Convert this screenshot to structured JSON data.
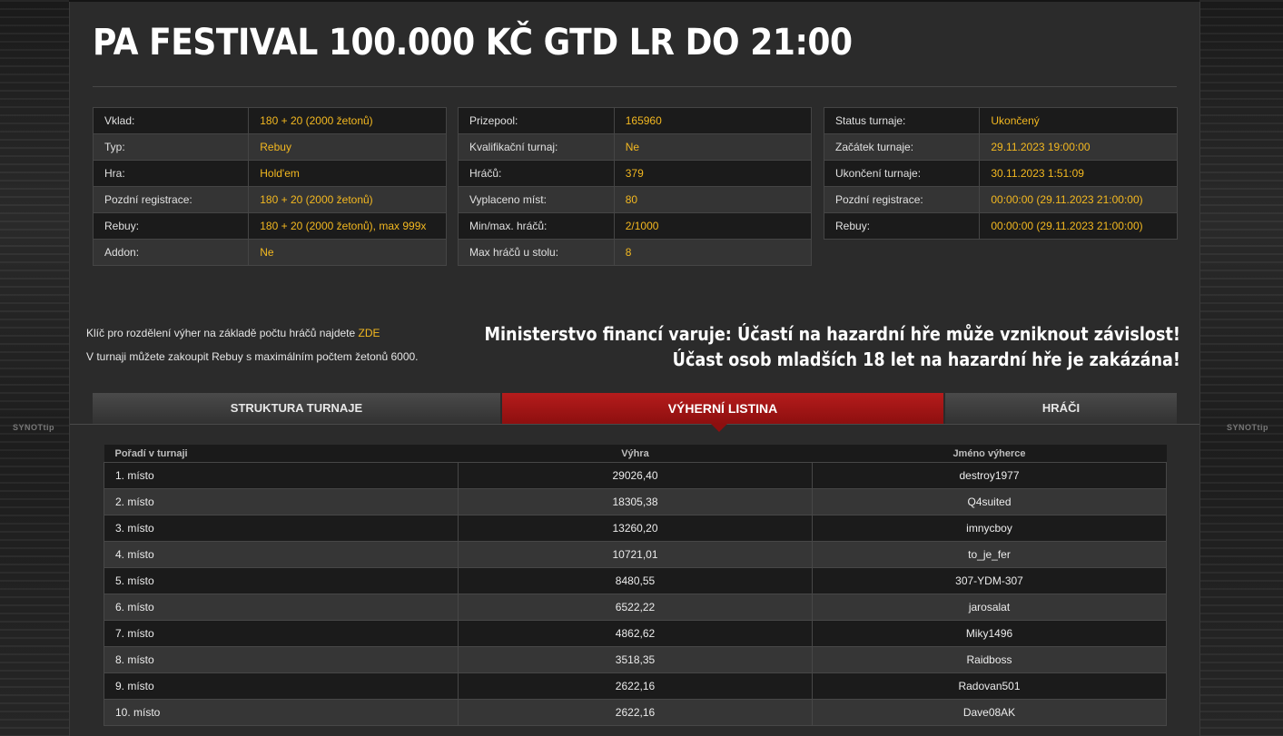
{
  "title": "PA FESTIVAL 100.000 KČ GTD LR DO 21:00",
  "background": {
    "logo_text": "SYNOTtip"
  },
  "colors": {
    "accent": "#f3b820",
    "tab_active": "#a31515",
    "panel": "#2b2b2b"
  },
  "info_left": [
    {
      "label": "Vklad:",
      "value": "180 + 20 (2000 žetonů)"
    },
    {
      "label": "Typ:",
      "value": "Rebuy"
    },
    {
      "label": "Hra:",
      "value": "Hold'em"
    },
    {
      "label": "Pozdní registrace:",
      "value": "180 + 20 (2000 žetonů)"
    },
    {
      "label": "Rebuy:",
      "value": "180 + 20 (2000 žetonů), max 999x"
    },
    {
      "label": "Addon:",
      "value": "Ne"
    }
  ],
  "info_middle": [
    {
      "label": "Prizepool:",
      "value": "165960"
    },
    {
      "label": "Kvalifikační turnaj:",
      "value": "Ne"
    },
    {
      "label": "Hráčů:",
      "value": "379"
    },
    {
      "label": "Vyplaceno míst:",
      "value": "80"
    },
    {
      "label": "Min/max. hráčů:",
      "value": "2/1000"
    },
    {
      "label": "Max hráčů u stolu:",
      "value": "8"
    }
  ],
  "info_right": [
    {
      "label": "Status turnaje:",
      "value": "Ukončený"
    },
    {
      "label": "Začátek turnaje:",
      "value": "29.11.2023 19:00:00"
    },
    {
      "label": "Ukončení turnaje:",
      "value": "30.11.2023 1:51:09"
    },
    {
      "label": "Pozdní registrace:",
      "value": "00:00:00 (29.11.2023 21:00:00)"
    },
    {
      "label": "Rebuy:",
      "value": "00:00:00 (29.11.2023 21:00:00)"
    }
  ],
  "notes": {
    "payout_key_text": "Klíč pro rozdělení výher na základě počtu hráčů najdete",
    "payout_key_link": "ZDE",
    "rebuy_text": "V turnaji můžete zakoupit Rebuy s maximálním počtem žetonů 6000."
  },
  "warning": {
    "line1": "Ministerstvo financí varuje: Účastí na hazardní hře může vzniknout závislost!",
    "line2": "Účast osob mladších 18 let na hazardní hře je zakázána!"
  },
  "tabs": [
    {
      "label": "STRUKTURA TURNAJE",
      "active": false
    },
    {
      "label": "VÝHERNÍ LISTINA",
      "active": true
    },
    {
      "label": "HRÁČI",
      "active": false
    }
  ],
  "results": {
    "headers": [
      "Pořadí v turnaji",
      "Výhra",
      "Jméno výherce"
    ],
    "rows": [
      [
        "1. místo",
        "29026,40",
        "destroy1977"
      ],
      [
        "2. místo",
        "18305,38",
        "Q4suited"
      ],
      [
        "3. místo",
        "13260,20",
        "imnycboy"
      ],
      [
        "4. místo",
        "10721,01",
        "to_je_fer"
      ],
      [
        "5. místo",
        "8480,55",
        "307-YDM-307"
      ],
      [
        "6. místo",
        "6522,22",
        "jarosalat"
      ],
      [
        "7. místo",
        "4862,62",
        "Miky1496"
      ],
      [
        "8. místo",
        "3518,35",
        "Raidboss"
      ],
      [
        "9. místo",
        "2622,16",
        "Radovan501"
      ],
      [
        "10. místo",
        "2622,16",
        "Dave08AK"
      ]
    ]
  }
}
